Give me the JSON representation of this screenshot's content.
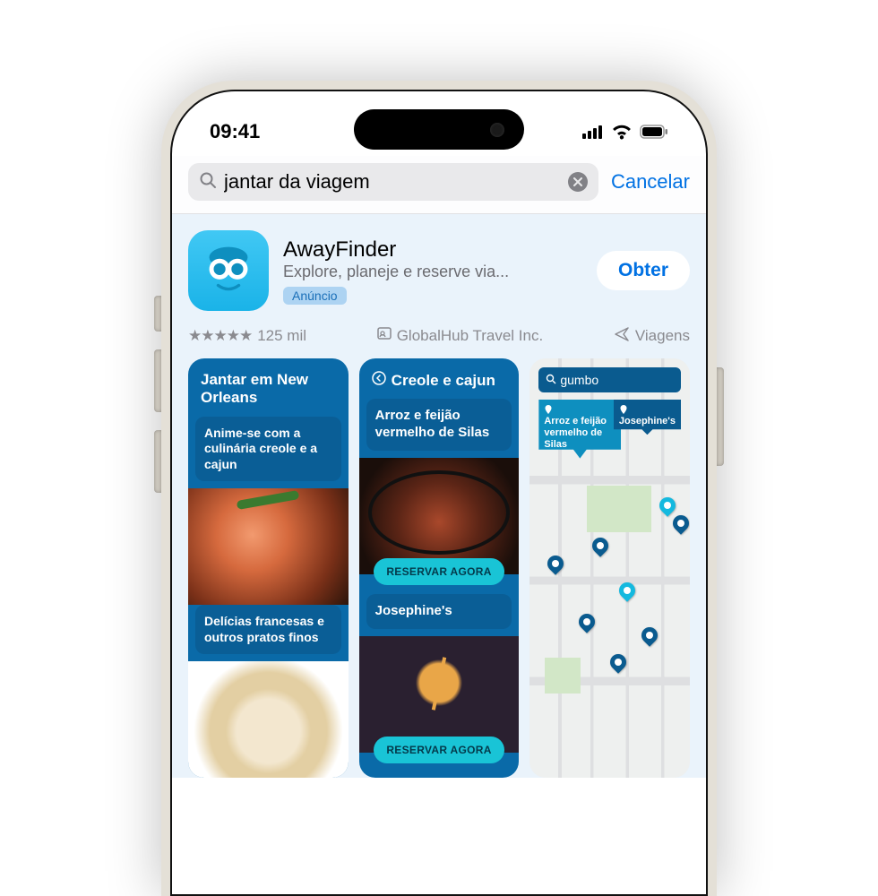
{
  "status": {
    "time": "09:41"
  },
  "search": {
    "query": "jantar da viagem",
    "cancel": "Cancelar"
  },
  "app": {
    "name": "AwayFinder",
    "subtitle": "Explore, planeje e reserve via...",
    "ad_badge": "Anúncio",
    "get_label": "Obter"
  },
  "info": {
    "rating_count": "125 mil",
    "developer": "GlobalHub Travel Inc.",
    "category": "Viagens"
  },
  "cards": {
    "c1": {
      "title": "Jantar em New Orleans",
      "sub1": "Anime-se com a culinária creole e a cajun",
      "sub2": "Delícias francesas e outros pratos finos"
    },
    "c2": {
      "title": "Creole e cajun",
      "item1": "Arroz e feijão vermelho de Silas",
      "item2": "Josephine's",
      "reserve": "RESERVAR AGORA"
    },
    "map": {
      "query": "gumbo",
      "label1": "Arroz e feijão vermelho de Silas",
      "label2": "Josephine's"
    }
  }
}
